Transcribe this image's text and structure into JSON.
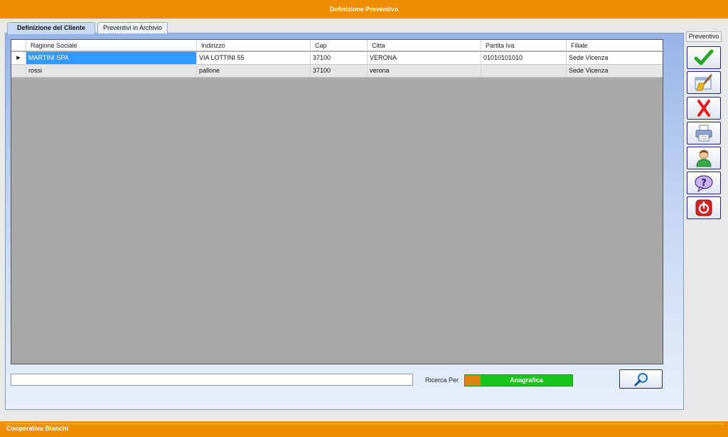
{
  "window": {
    "title": "Definizione Preventivo"
  },
  "tabs": [
    {
      "label": "Definizione del Cliente",
      "active": true
    },
    {
      "label": "Preventivi in Archivio",
      "active": false
    }
  ],
  "grid": {
    "columns": [
      "Ragione Sociale",
      "Indirizzo",
      "Cap",
      "Citta",
      "Partita Iva",
      "Filiale"
    ],
    "rows": [
      [
        "MARTINI SPA",
        "VIA LOTTINI 55",
        "37100",
        "VERONA",
        "01010101010",
        "Sede Vicenza"
      ],
      [
        "rossi",
        "pallone",
        "37100",
        "verona",
        "",
        "Sede Vicenza"
      ]
    ],
    "selected_row": 0
  },
  "search": {
    "value": "",
    "ricerca_label": "Ricerca Per",
    "mode_label": "Anagrafica"
  },
  "toolbar": {
    "title": "Preventivo",
    "buttons": [
      {
        "icon": "checkmark-icon"
      },
      {
        "icon": "broom-clear-icon"
      },
      {
        "icon": "delete-x-icon"
      },
      {
        "icon": "printer-icon"
      },
      {
        "icon": "user-icon"
      },
      {
        "icon": "help-icon"
      },
      {
        "icon": "power-exit-icon"
      }
    ]
  },
  "status": {
    "text": "Cooperativa Bianchi"
  },
  "colors": {
    "accent": "#ef8c00",
    "selection": "#3399ff",
    "toggle_on": "#19c41b"
  }
}
